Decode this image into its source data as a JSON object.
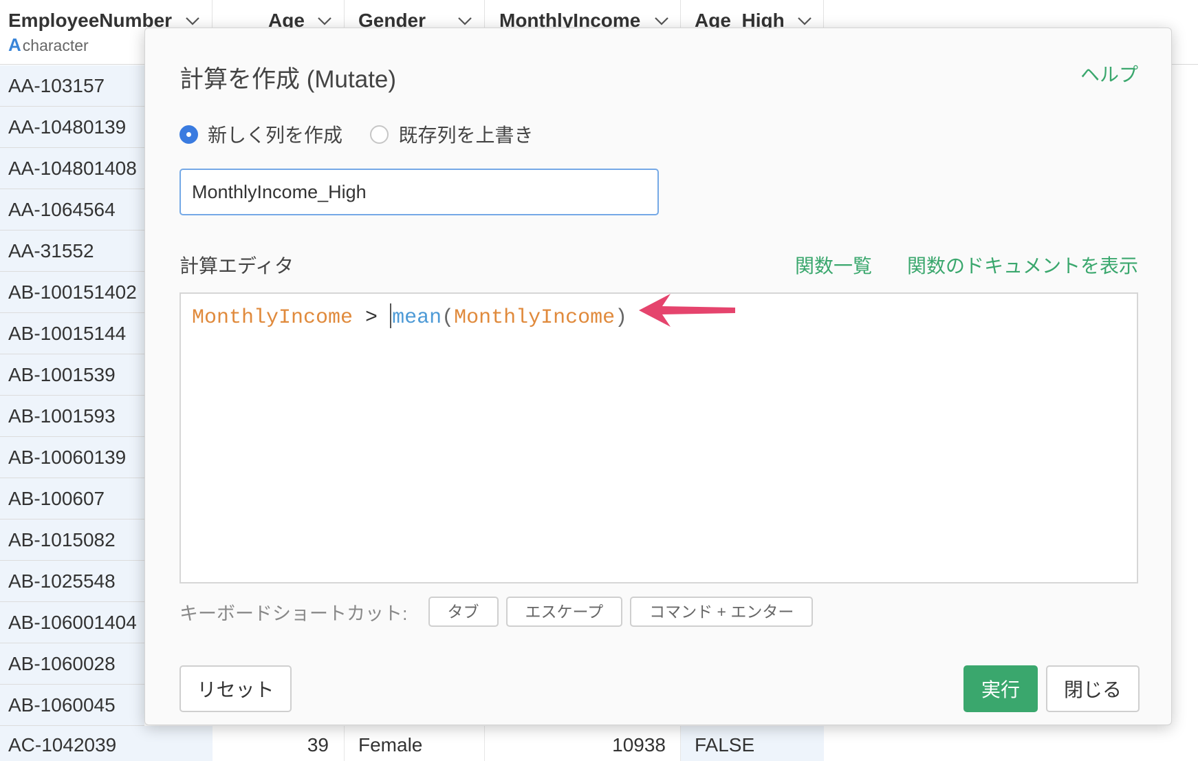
{
  "grid": {
    "columns": [
      {
        "label": "EmployeeNumber"
      },
      {
        "label": "Age"
      },
      {
        "label": "Gender"
      },
      {
        "label": "MonthlyIncome"
      },
      {
        "label": "Age_High"
      }
    ],
    "first_column_type_icon": "A",
    "first_column_type": "character",
    "employee_numbers": [
      "AA-103157",
      "AA-10480139",
      "AA-104801408",
      "AA-1064564",
      "AA-31552",
      "AB-100151402",
      "AB-10015144",
      "AB-1001539",
      "AB-1001593",
      "AB-10060139",
      "AB-100607",
      "AB-1015082",
      "AB-1025548",
      "AB-106001404",
      "AB-1060028",
      "AB-1060045"
    ],
    "last_row": {
      "employee_number": "AC-1042039",
      "age": "39",
      "gender": "Female",
      "monthly_income": "10938",
      "age_high": "FALSE"
    }
  },
  "modal": {
    "title": "計算を作成 (Mutate)",
    "help": "ヘルプ",
    "radio_new": "新しく列を作成",
    "radio_overwrite": "既存列を上書き",
    "selected_mode": "new",
    "column_name_value": "MonthlyIncome_High",
    "editor_label": "計算エディタ",
    "function_list_link": "関数一覧",
    "function_docs_link": "関数のドキュメントを表示",
    "code": {
      "tok1": "MonthlyIncome",
      "tok2": " > ",
      "tok3": "mean",
      "tok4": "(",
      "tok5": "MonthlyIncome",
      "tok6": ")"
    },
    "shortcut_label": "キーボードショートカット:",
    "shortcut_keys": [
      "タブ",
      "エスケープ",
      "コマンド + エンター"
    ],
    "reset_button": "リセット",
    "run_button": "実行",
    "close_button": "閉じる"
  },
  "colors": {
    "accent_green": "#3aa76d",
    "radio_blue": "#3a7be0",
    "code_column": "#e08a3c",
    "code_function": "#4d9ad6",
    "annotation_arrow": "#e5446d"
  },
  "icons": {
    "dropdown": "chevron-down-icon",
    "annotation": "arrow-left-annotation-icon"
  }
}
